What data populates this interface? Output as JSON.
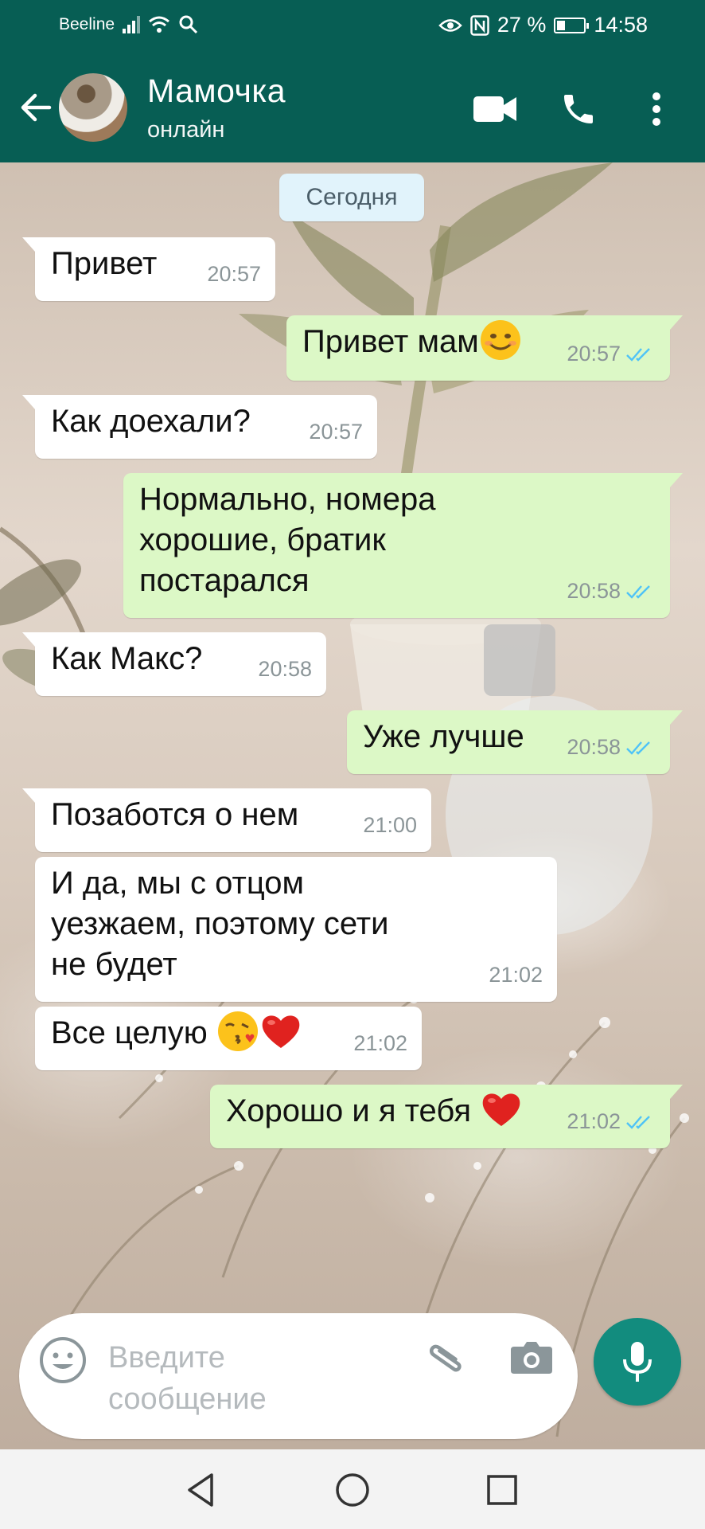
{
  "status_bar": {
    "carrier": "Beeline",
    "battery": "27 %",
    "battery_level": 0.27,
    "time": "14:58"
  },
  "header": {
    "contact_name": "Мамочка",
    "contact_status": "онлайн",
    "icons": [
      "back-arrow-icon",
      "video-call-icon",
      "phone-icon",
      "more-vert-icon"
    ]
  },
  "chat": {
    "date_separator": "Сегодня",
    "messages": [
      {
        "dir": "in",
        "text": "Привет",
        "time": "20:57"
      },
      {
        "dir": "out",
        "text": "Привет мам",
        "emoji": [
          "smile"
        ],
        "time": "20:57",
        "read": true
      },
      {
        "dir": "in",
        "text": "Как доехали?",
        "time": "20:57"
      },
      {
        "dir": "out",
        "text": "Нормально, номера\nхорошие, братик\nпостарался",
        "time": "20:58",
        "read": true
      },
      {
        "dir": "in",
        "text": "Как Макс?",
        "time": "20:58"
      },
      {
        "dir": "out",
        "text": "Уже лучше",
        "time": "20:58",
        "read": true
      },
      {
        "dir": "in",
        "text": "Позаботся о нем",
        "time": "21:00"
      },
      {
        "dir": "in",
        "text": "И да, мы с отцом\nуезжаем, поэтому сети\nне будет",
        "time": "21:02"
      },
      {
        "dir": "in",
        "text": "Все целую ",
        "emoji": [
          "kiss",
          "heart"
        ],
        "time": "21:02"
      },
      {
        "dir": "out",
        "text": "Хорошо и я тебя ",
        "emoji": [
          "heart"
        ],
        "time": "21:02",
        "read": true
      }
    ]
  },
  "composer": {
    "placeholder": "Введите сообщение"
  },
  "colors": {
    "header": "#075e54",
    "incoming": "#ffffff",
    "outgoing": "#dcf8c6",
    "read_ticks": "#4fc3f7",
    "mic_button": "#128c7e"
  }
}
